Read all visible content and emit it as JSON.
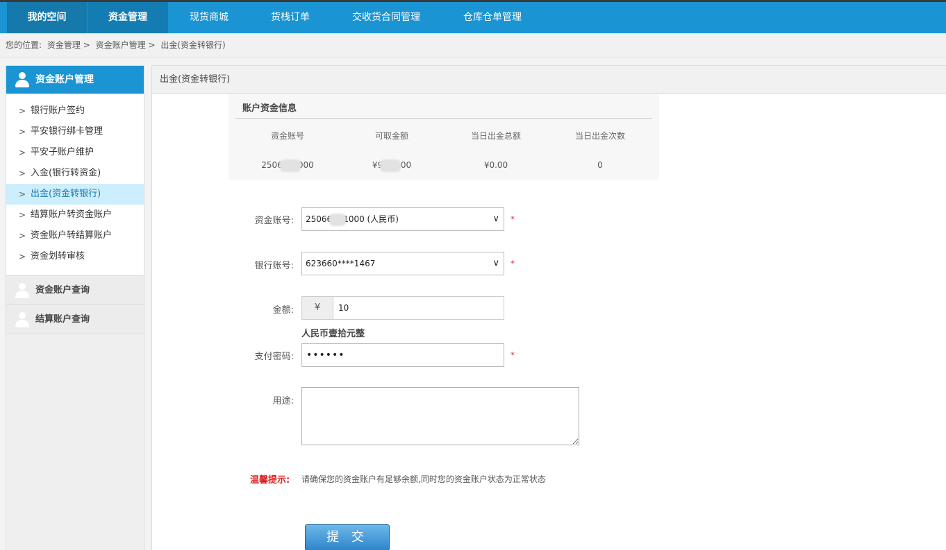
{
  "topnav": {
    "items": [
      "我的空间",
      "资金管理",
      "现货商城",
      "货栈订单",
      "交收货合同管理",
      "仓库仓单管理"
    ]
  },
  "breadcrumb": {
    "prefix": "您的位置:",
    "items": [
      "资金管理",
      "资金账户管理",
      "出金(资金转银行)"
    ],
    "sep": ">"
  },
  "sidebar": {
    "header": "资金账户管理",
    "items": [
      "银行账户签约",
      "平安银行绑卡管理",
      "平安子账户维护",
      "入金(银行转资金)",
      "出金(资金转银行)",
      "结算账户转资金账户",
      "资金账户转结算账户",
      "资金划转审核"
    ],
    "sections": [
      "资金账户查询",
      "结算账户查询"
    ]
  },
  "main": {
    "title": "出金(资金转银行)",
    "info": {
      "title": "账户资金信息",
      "headers": [
        "资金账号",
        "可取金额",
        "当日出金总额",
        "当日出金次数"
      ],
      "values": {
        "account_prefix": "2506",
        "account_suffix": "000",
        "available_prefix": "¥9",
        "available_suffix": ".00",
        "daily_total": "¥0.00",
        "daily_count": "0"
      }
    },
    "form": {
      "account_label": "资金账号:",
      "account_prefix": "25066",
      "account_suffix": "1000 (人民币)",
      "bank_label": "银行账号:",
      "bank_value": "623660****1467",
      "amount_label": "金额:",
      "currency": "¥",
      "amount_value": "10",
      "amount_words": "人民币壹拾元整",
      "password_label": "支付密码:",
      "password_value": "••••••",
      "purpose_label": "用途:",
      "required_mark": "*",
      "tip_label": "温馨提示:",
      "tip_text": "请确保您的资金账户有足够余额,同时您的资金账户状态为正常状态",
      "submit": "提 交"
    }
  }
}
